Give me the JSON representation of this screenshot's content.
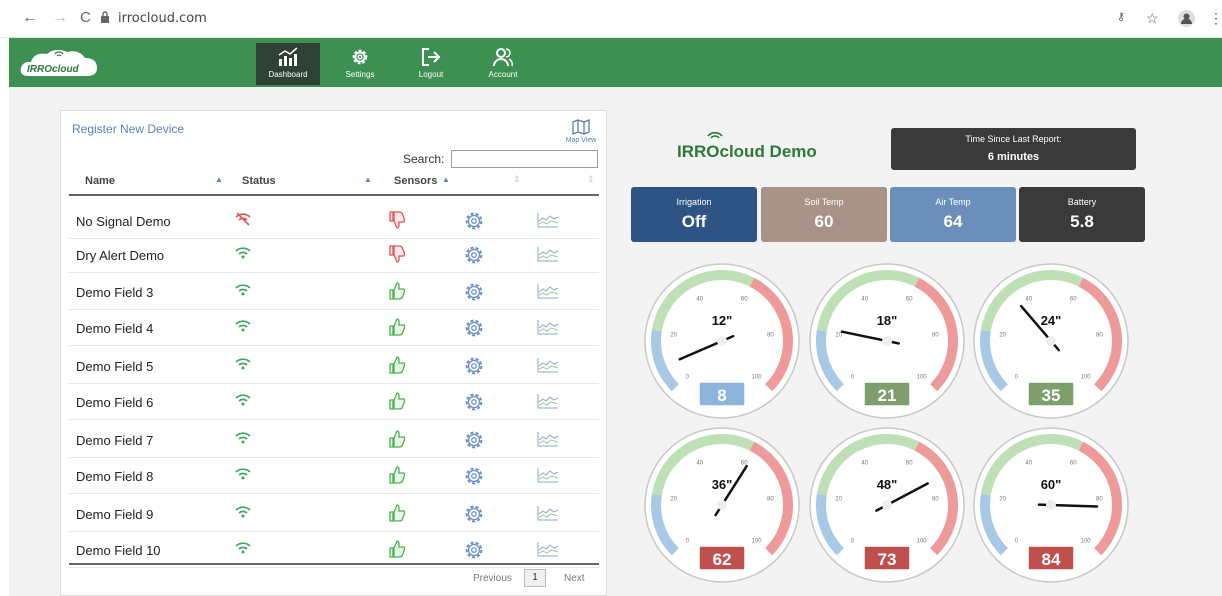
{
  "browser": {
    "back": "←",
    "forward": "→",
    "reload": "C",
    "url": "irrocloud.com"
  },
  "app": {
    "logo_text": "IRROcloud",
    "nav": [
      {
        "label": "Dashboard",
        "icon": "chart-icon",
        "active": true
      },
      {
        "label": "Settings",
        "icon": "gear-icon",
        "active": false
      },
      {
        "label": "Logout",
        "icon": "logout-icon",
        "active": false
      },
      {
        "label": "Account",
        "icon": "account-icon",
        "active": false
      }
    ],
    "accent": "#3d8f52"
  },
  "devices": {
    "register_link": "Register New Device",
    "map_view": "Map View",
    "search_label": "Search:",
    "columns": [
      "Name",
      "Status",
      "Sensors"
    ],
    "rows": [
      {
        "name": "No Signal Demo",
        "signal": "no-signal",
        "sensors": "thumbs-down"
      },
      {
        "name": "Dry Alert Demo",
        "signal": "ok",
        "sensors": "thumbs-down"
      },
      {
        "name": "Demo Field 3",
        "signal": "ok",
        "sensors": "thumbs-up"
      },
      {
        "name": "Demo Field 4",
        "signal": "ok",
        "sensors": "thumbs-up"
      },
      {
        "name": "Demo Field 5",
        "signal": "ok",
        "sensors": "thumbs-up"
      },
      {
        "name": "Demo Field 6",
        "signal": "ok",
        "sensors": "thumbs-up"
      },
      {
        "name": "Demo Field 7",
        "signal": "ok",
        "sensors": "thumbs-up"
      },
      {
        "name": "Demo Field 8",
        "signal": "ok",
        "sensors": "thumbs-up"
      },
      {
        "name": "Demo Field 9",
        "signal": "ok",
        "sensors": "thumbs-up"
      },
      {
        "name": "Demo Field 10",
        "signal": "ok",
        "sensors": "thumbs-up"
      }
    ],
    "pager": {
      "previous": "Previous",
      "page": "1",
      "next": "Next"
    }
  },
  "dashboard": {
    "title": "IRROcloud Demo",
    "time_label": "Time Since Last Report:",
    "time_value": "6 minutes",
    "tiles": [
      {
        "label": "Irrigation",
        "value": "Off",
        "color": "#2e5385"
      },
      {
        "label": "Soil Temp",
        "value": "60",
        "color": "#a99388"
      },
      {
        "label": "Air Temp",
        "value": "64",
        "color": "#6b8fba"
      },
      {
        "label": "Battery",
        "value": "5.8",
        "color": "#3a3a3a"
      }
    ],
    "gauges": [
      {
        "depth": "12\"",
        "value": 8,
        "box_color": "#8db4dc"
      },
      {
        "depth": "18\"",
        "value": 21,
        "box_color": "#7e9e6c"
      },
      {
        "depth": "24\"",
        "value": 35,
        "box_color": "#7e9e6c"
      },
      {
        "depth": "36\"",
        "value": 62,
        "box_color": "#c0504d"
      },
      {
        "depth": "48\"",
        "value": 73,
        "box_color": "#c0504d"
      },
      {
        "depth": "60\"",
        "value": 84,
        "box_color": "#c0504d"
      }
    ],
    "gauge_ticks": [
      "0",
      "20",
      "40",
      "60",
      "80",
      "100"
    ]
  }
}
